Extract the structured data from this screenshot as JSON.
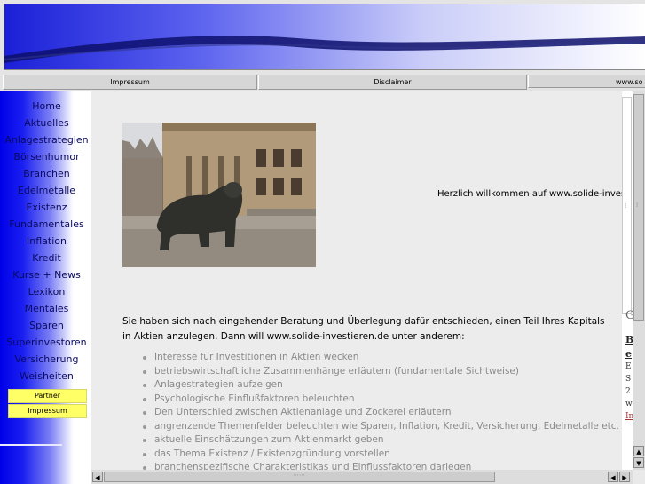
{
  "topnav": {
    "impressum": "Impressum",
    "disclaimer": "Disclaimer",
    "third": "www.so"
  },
  "sidebar": {
    "items": [
      {
        "label": "Home"
      },
      {
        "label": "Aktuelles"
      },
      {
        "label": "Anlagestrategien"
      },
      {
        "label": "Börsenhumor"
      },
      {
        "label": "Branchen"
      },
      {
        "label": "Edelmetalle"
      },
      {
        "label": "Existenz"
      },
      {
        "label": "Fundamentales"
      },
      {
        "label": "Inflation"
      },
      {
        "label": "Kredit"
      },
      {
        "label": "Kurse + News"
      },
      {
        "label": "Lexikon"
      },
      {
        "label": "Mentales"
      },
      {
        "label": "Sparen"
      },
      {
        "label": "Superinvestoren"
      },
      {
        "label": "Versicherung"
      },
      {
        "label": "Weisheiten"
      }
    ],
    "partner": "Partner",
    "impressum": "Impressum"
  },
  "main": {
    "welcome": "Herzlich willkommen auf www.solide-investie",
    "intro": "Sie haben sich nach eingehender Beratung und Überlegung dafür entschieden, einen Teil Ihres Kapitals in Aktien anzulegen. Dann will www.solide-investieren.de unter anderem:",
    "bullets": [
      "Interesse für Investitionen in Aktien wecken",
      "betriebswirtschaftliche Zusammenhänge erläutern (fundamentale Sichtweise)",
      "Anlagestrategien aufzeigen",
      "Psychologische Einflußfaktoren beleuchten",
      "Den Unterschied zwischen Aktienanlage und Zockerei erläutern",
      "angrenzende Themenfelder beleuchten wie Sparen, Inflation, Kredit, Versicherung, Edelmetalle etc.",
      "aktuelle Einschätzungen zum Aktienmarkt geben",
      "das Thema Existenz / Existenzgründung vorstellen",
      "branchenspezifische Charakteristikas und Einflussfaktoren darlegen"
    ]
  },
  "right_pane": {
    "g": "G",
    "b": "B",
    "e": "e",
    "e2": "E",
    "s": "S",
    "n": "2",
    "w": "w",
    "link": "In"
  },
  "colors": {
    "sidebar_blue": "#0000e8",
    "button_yellow": "#ffff66",
    "bullet_gray": "#8a8a8a"
  },
  "scroll_icons": [
    "arrow-up-icon",
    "arrow-down-icon",
    "arrow-left-icon",
    "arrow-right-icon"
  ]
}
